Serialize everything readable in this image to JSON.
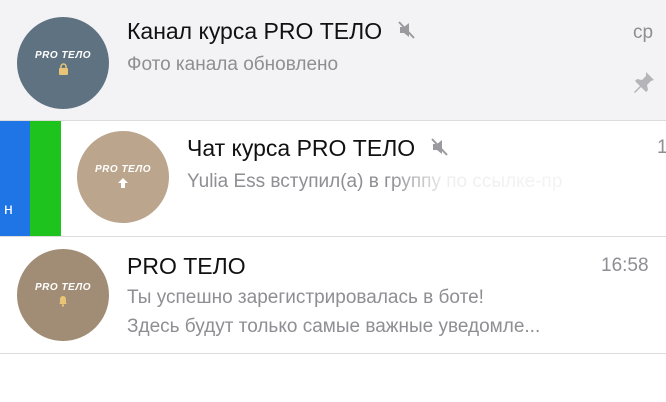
{
  "chats": [
    {
      "avatar_text": "PRO ТЕЛО",
      "avatar_icon": "lock-icon",
      "title": "Канал курса PRO ТЕЛО",
      "muted": true,
      "subtitle": "Фото канала обновлено",
      "time": "ср",
      "pinned": true
    },
    {
      "avatar_text": "PRO ТЕЛО",
      "avatar_icon": "arrow-icon",
      "title": "Чат курса PRO ТЕЛО",
      "muted": true,
      "subtitle": "Yulia Ess вступил(а) в группу по ссылке-пр",
      "time": "1",
      "swipe_label": "н"
    },
    {
      "avatar_text": "PRO ТЕЛО",
      "avatar_icon": "bell-icon",
      "title": "PRO ТЕЛО",
      "subtitle_line1": "Ты успешно зарегистрировалась в боте!",
      "subtitle_line2": "Здесь будут только самые важные уведомле...",
      "time": "16:58"
    }
  ],
  "colors": {
    "accent": "#1a73e8",
    "swipe_blue": "#1f74e6",
    "swipe_green": "#1ec31e",
    "avatar1": "#5f7282",
    "avatar2": "#bba58c",
    "avatar3": "#a18d76"
  }
}
